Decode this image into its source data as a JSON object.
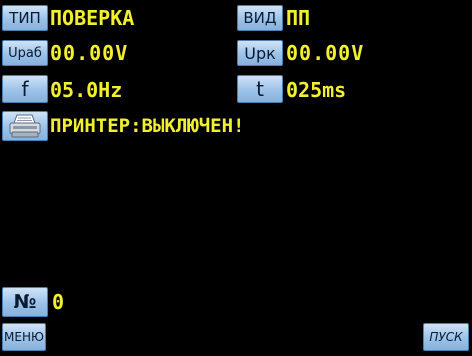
{
  "params": {
    "type": {
      "label": "ТИП",
      "value": "ПОВЕРКА"
    },
    "view": {
      "label": "ВИД",
      "value": "ПП"
    },
    "urab": {
      "label": "Uраб",
      "value": "00.00V"
    },
    "urk": {
      "label": "Uрк",
      "value": "00.00V"
    },
    "freq": {
      "label": "f",
      "value": "05.0Hz"
    },
    "time": {
      "label": "t",
      "value": "025ms"
    }
  },
  "printer": {
    "icon": "printer-icon",
    "status": "ПРИНТЕР:ВЫКЛЮЧЕН!"
  },
  "counter": {
    "label": "№",
    "value": "0"
  },
  "footer": {
    "menu_label": "МЕНЮ",
    "start_label": "ПУСК"
  },
  "colors": {
    "background": "#000000",
    "value_text": "#f2ef2e",
    "button_face": "#9cc2e8"
  }
}
